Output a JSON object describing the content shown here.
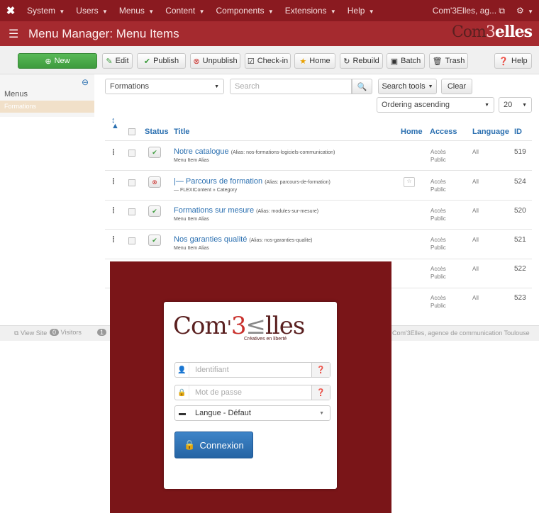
{
  "navbar": {
    "logo_icon": "joomla-icon",
    "items": [
      {
        "label": "System"
      },
      {
        "label": "Users"
      },
      {
        "label": "Menus"
      },
      {
        "label": "Content"
      },
      {
        "label": "Components"
      },
      {
        "label": "Extensions"
      },
      {
        "label": "Help"
      }
    ],
    "site_label": "Com'3Elles, ag...",
    "settings_icon": "gear-icon"
  },
  "header": {
    "title": "Menu Manager: Menu Items",
    "brand": {
      "part1": "Com",
      "part2": "3",
      "part3": "elles"
    }
  },
  "toolbar": {
    "new_label": "New",
    "edit_label": "Edit",
    "publish_label": "Publish",
    "unpublish_label": "Unpublish",
    "checkin_label": "Check-in",
    "home_label": "Home",
    "rebuild_label": "Rebuild",
    "batch_label": "Batch",
    "trash_label": "Trash",
    "help_label": "Help"
  },
  "sidebar": {
    "menus_label": "Menus",
    "active_item": "Formations"
  },
  "filters": {
    "menu_select": "Formations",
    "search_placeholder": "Search",
    "search_tools_label": "Search tools",
    "clear_label": "Clear",
    "ordering_select": "Ordering ascending",
    "limit_select": "20"
  },
  "table": {
    "headers": {
      "status": "Status",
      "title": "Title",
      "home": "Home",
      "access": "Access",
      "language": "Language",
      "id": "ID"
    },
    "rows": [
      {
        "title": "Notre catalogue",
        "alias": "(Alias: nos-formations-logiciels-communication)",
        "sub": "Menu Item Alias",
        "status": "published",
        "access1": "Accès",
        "access2": "Public",
        "language": "All",
        "id": "519"
      },
      {
        "title": "|— Parcours de formation",
        "alias": "(Alias: parcours-de-formation)",
        "sub": "— FLEXIContent » Category",
        "status": "unpublished",
        "access1": "Accès",
        "access2": "Public",
        "language": "All",
        "id": "524"
      },
      {
        "title": "Formations sur mesure",
        "alias": "(Alias: modules-sur-mesure)",
        "sub": "Menu Item Alias",
        "status": "published",
        "access1": "Accès",
        "access2": "Public",
        "language": "All",
        "id": "520"
      },
      {
        "title": "Nos garanties qualité",
        "alias": "(Alias: nos-garanties-qualite)",
        "sub": "Menu Item Alias",
        "status": "published",
        "access1": "Accès",
        "access2": "Public",
        "language": "All",
        "id": "521"
      },
      {
        "title": "",
        "alias": "",
        "sub": "",
        "status": "",
        "access1": "Accès",
        "access2": "Public",
        "language": "All",
        "id": "522"
      },
      {
        "title": "",
        "alias": "",
        "sub": "",
        "status": "",
        "access1": "Accès",
        "access2": "Public",
        "language": "All",
        "id": "523"
      }
    ]
  },
  "footer": {
    "view_site": "View Site",
    "visitors_count": "0",
    "visitors_label": "Visitors",
    "admins_count": "1",
    "copyright": "Com'3Elles, agence de communication Toulouse"
  },
  "login": {
    "brand": {
      "part1": "Com",
      "part2": "3",
      "part3": "lles",
      "tagline": "Créatives en liberté"
    },
    "username_placeholder": "Identifiant",
    "password_placeholder": "Mot de passe",
    "language_select": "Langue - Défaut",
    "submit_label": "Connexion"
  },
  "colors": {
    "navbar": "#8a1a20",
    "header": "#a52a2f",
    "modal_backdrop": "#7a1518",
    "link": "#2a6fb0",
    "primary_button": "#2f74b8"
  }
}
